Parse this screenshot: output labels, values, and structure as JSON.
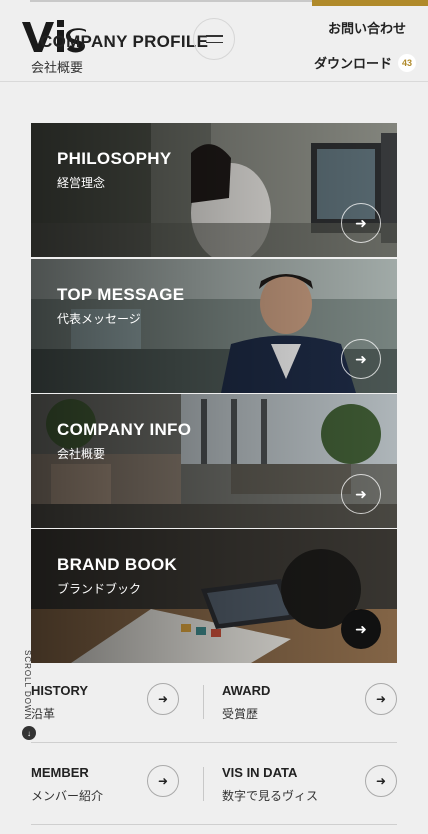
{
  "header": {
    "logo_text": "VIS",
    "title_en": "COMPANY PROFILE",
    "title_ja": "会社概要",
    "contact_label": "お問い合わせ",
    "download_label": "ダウンロード",
    "download_count": "43"
  },
  "cards": [
    {
      "title": "PHILOSOPHY",
      "subtitle": "経営理念"
    },
    {
      "title": "TOP MESSAGE",
      "subtitle": "代表メッセージ"
    },
    {
      "title": "COMPANY INFO",
      "subtitle": "会社概要"
    },
    {
      "title": "BRAND BOOK",
      "subtitle": "ブランドブック"
    }
  ],
  "links": [
    {
      "title": "HISTORY",
      "subtitle": "沿革"
    },
    {
      "title": "AWARD",
      "subtitle": "受賞歴"
    },
    {
      "title": "MEMBER",
      "subtitle": "メンバー紹介"
    },
    {
      "title": "VIS IN DATA",
      "subtitle": "数字で見るヴィス"
    }
  ],
  "scroll_label": "SCROLL DOWN",
  "icons": {
    "arrow": "arrow-right-icon",
    "menu": "hamburger-icon",
    "scroll": "arrow-down-icon"
  },
  "colors": {
    "accent": "#b08a2a",
    "background": "#efefef"
  }
}
